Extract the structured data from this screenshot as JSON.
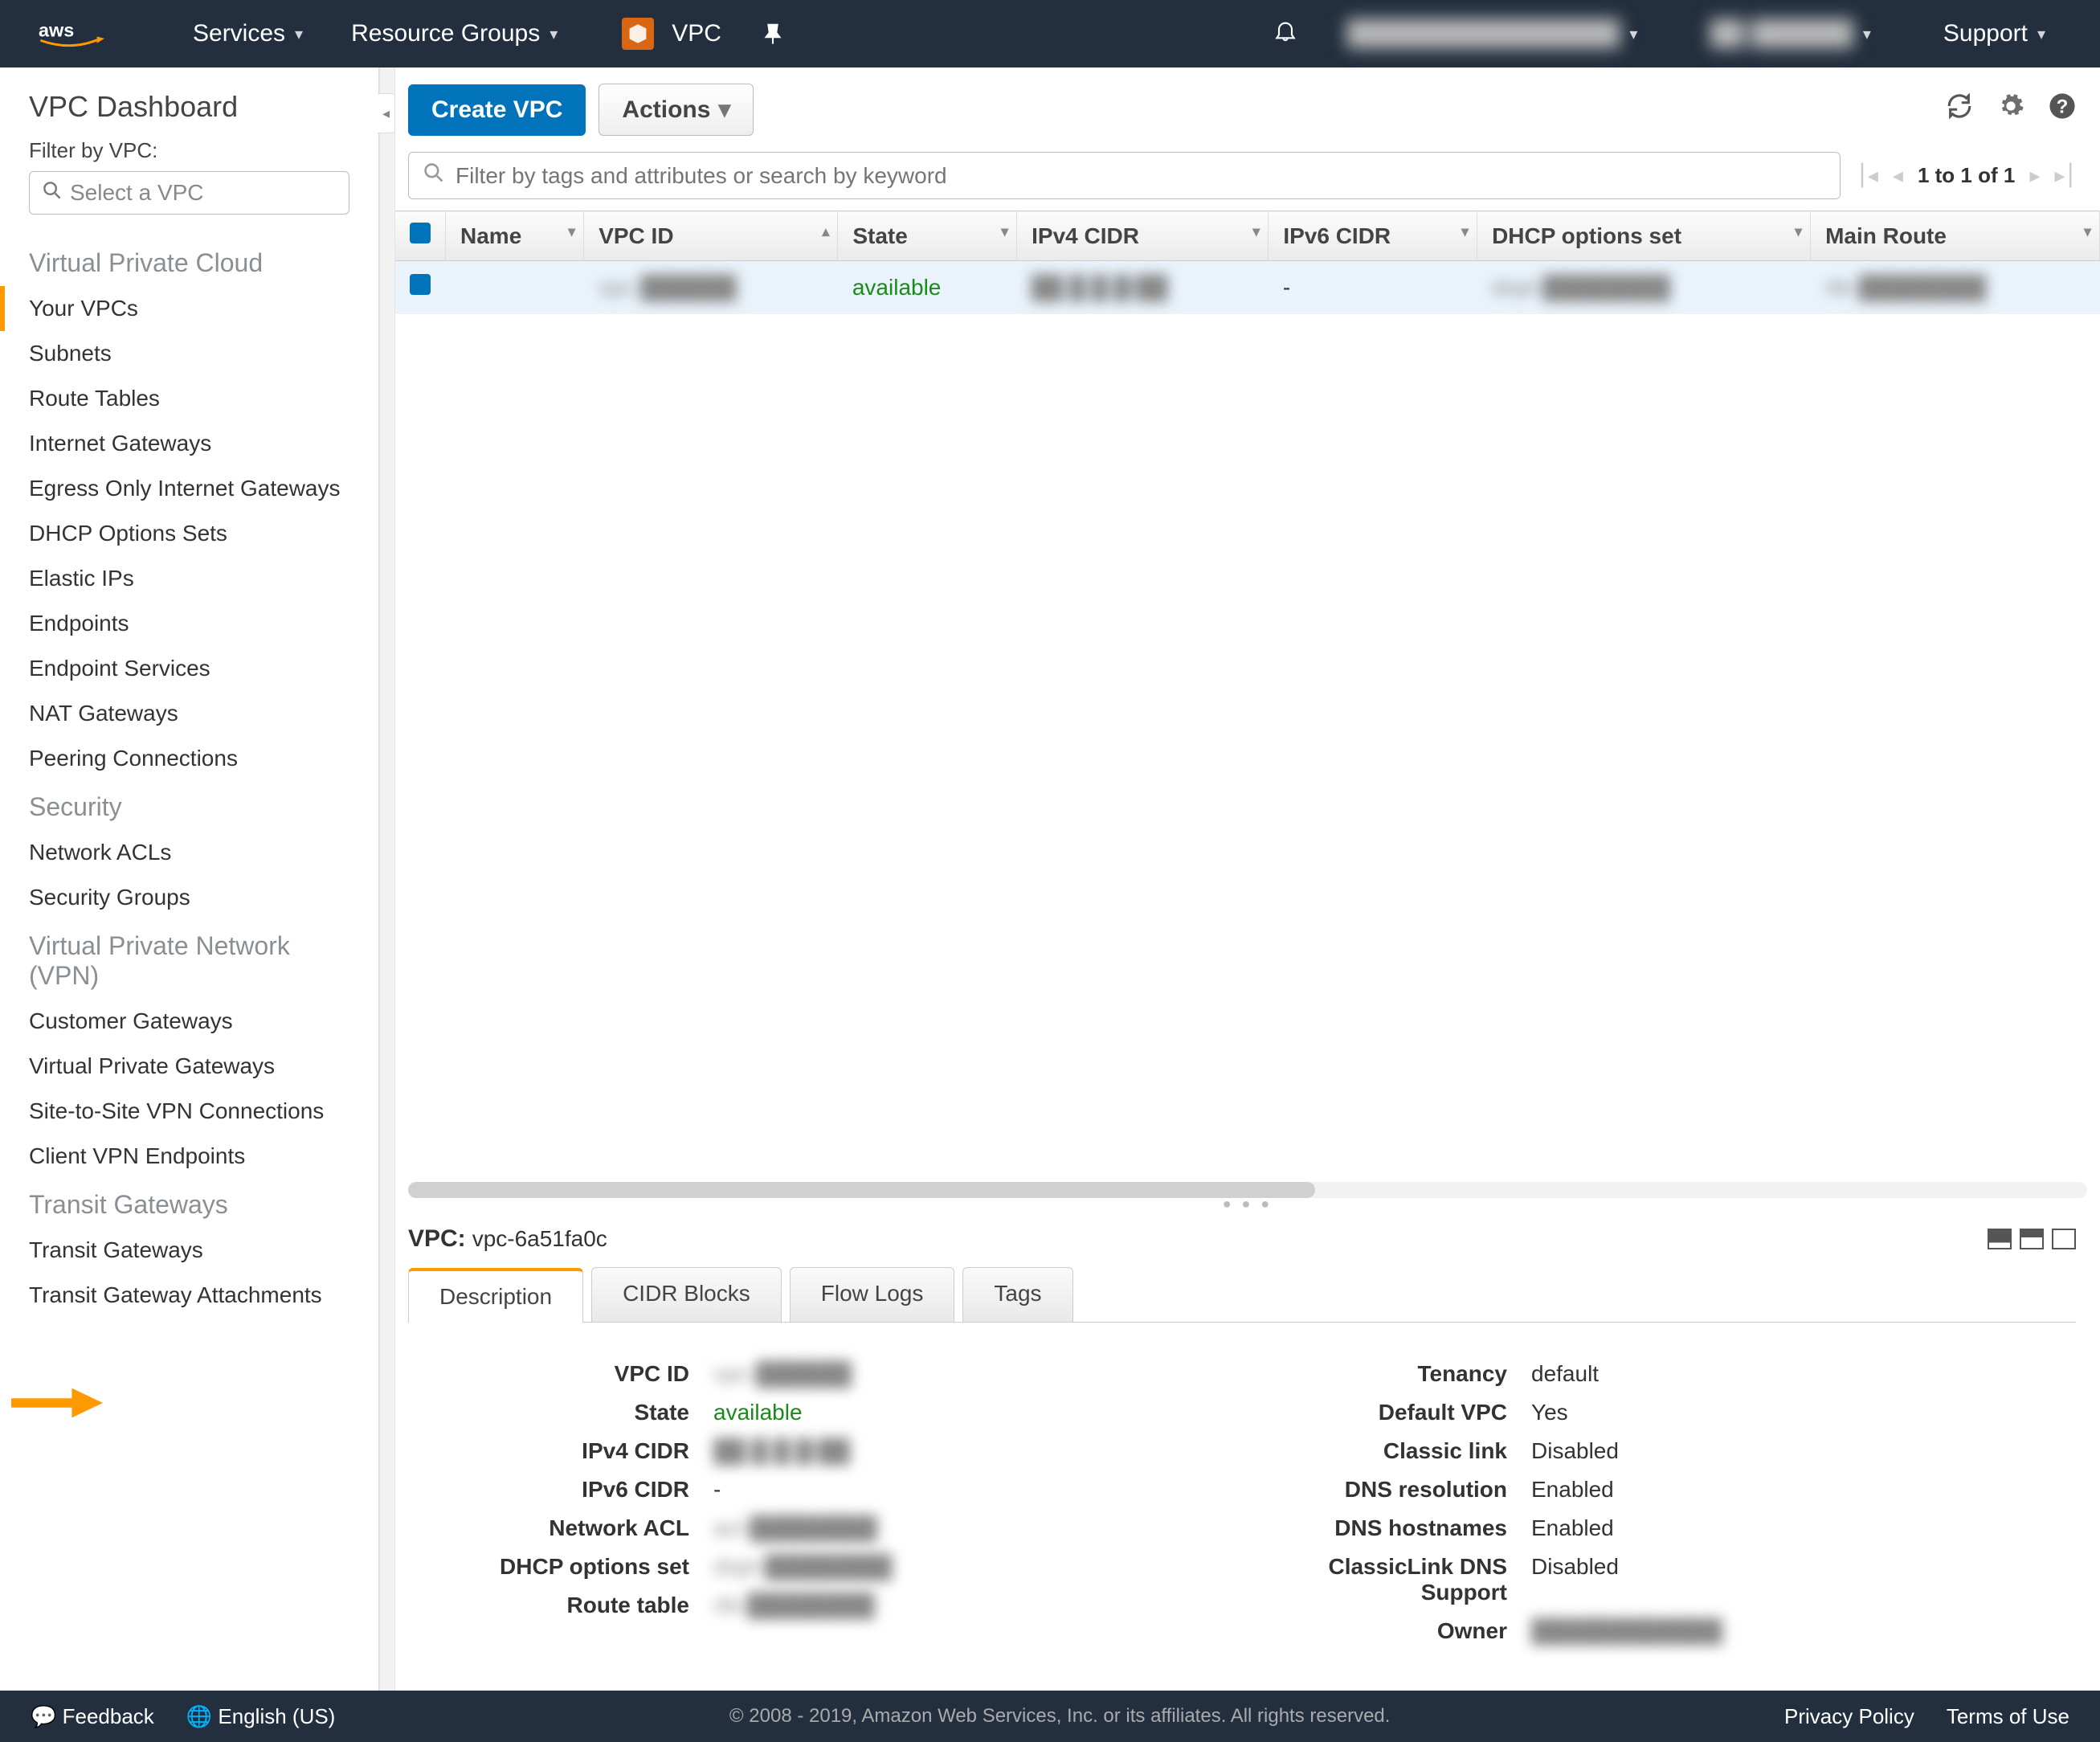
{
  "topnav": {
    "services": "Services",
    "resource_groups": "Resource Groups",
    "vpc_label": "VPC",
    "support": "Support",
    "account_blur": "████████████████",
    "region_blur": "██ ██████"
  },
  "sidebar": {
    "title": "VPC Dashboard",
    "filter_label": "Filter by VPC:",
    "select_placeholder": "Select a VPC",
    "groups": [
      {
        "label": "Virtual Private Cloud",
        "items": [
          {
            "label": "Your VPCs",
            "active": true
          },
          {
            "label": "Subnets"
          },
          {
            "label": "Route Tables"
          },
          {
            "label": "Internet Gateways"
          },
          {
            "label": "Egress Only Internet Gateways"
          },
          {
            "label": "DHCP Options Sets"
          },
          {
            "label": "Elastic IPs"
          },
          {
            "label": "Endpoints"
          },
          {
            "label": "Endpoint Services"
          },
          {
            "label": "NAT Gateways"
          },
          {
            "label": "Peering Connections"
          }
        ]
      },
      {
        "label": "Security",
        "items": [
          {
            "label": "Network ACLs"
          },
          {
            "label": "Security Groups"
          }
        ]
      },
      {
        "label": "Virtual Private Network (VPN)",
        "items": [
          {
            "label": "Customer Gateways"
          },
          {
            "label": "Virtual Private Gateways"
          },
          {
            "label": "Site-to-Site VPN Connections"
          },
          {
            "label": "Client VPN Endpoints"
          }
        ]
      },
      {
        "label": "Transit Gateways",
        "items": [
          {
            "label": "Transit Gateways"
          },
          {
            "label": "Transit Gateway Attachments"
          }
        ]
      }
    ]
  },
  "toolbar": {
    "create": "Create VPC",
    "actions": "Actions"
  },
  "search": {
    "placeholder": "Filter by tags and attributes or search by keyword"
  },
  "pager": {
    "range": "1 to 1 of 1"
  },
  "table": {
    "headers": [
      "",
      "Name",
      "VPC ID",
      "State",
      "IPv4 CIDR",
      "IPv6 CIDR",
      "DHCP options set",
      "Main Route"
    ],
    "rows": [
      {
        "name": "",
        "vpc_id": "vpc-██████",
        "state": "available",
        "ipv4": "██.█.█.█/██",
        "ipv6": "-",
        "dhcp": "dopt-████████",
        "route": "rtb-████████"
      }
    ]
  },
  "details": {
    "header_label": "VPC:",
    "header_value": "vpc-6a51fa0c",
    "tabs": [
      "Description",
      "CIDR Blocks",
      "Flow Logs",
      "Tags"
    ],
    "left": [
      {
        "k": "VPC ID",
        "v": "vpc-██████",
        "blur": true
      },
      {
        "k": "State",
        "v": "available",
        "green": true
      },
      {
        "k": "IPv4 CIDR",
        "v": "██.█.█.█/██",
        "blur": true
      },
      {
        "k": "IPv6 CIDR",
        "v": "-"
      },
      {
        "k": "Network ACL",
        "v": "acl-████████",
        "blur": true,
        "link": true
      },
      {
        "k": "DHCP options set",
        "v": "dopt-████████",
        "blur": true,
        "link": true
      },
      {
        "k": "Route table",
        "v": "rtb-████████",
        "blur": true,
        "link": true
      }
    ],
    "right": [
      {
        "k": "Tenancy",
        "v": "default"
      },
      {
        "k": "Default VPC",
        "v": "Yes"
      },
      {
        "k": "Classic link",
        "v": "Disabled"
      },
      {
        "k": "DNS resolution",
        "v": "Enabled"
      },
      {
        "k": "DNS hostnames",
        "v": "Enabled"
      },
      {
        "k": "ClassicLink DNS Support",
        "v": "Disabled"
      },
      {
        "k": "Owner",
        "v": "████████████",
        "blur": true
      }
    ]
  },
  "footer": {
    "feedback": "Feedback",
    "lang": "English (US)",
    "copyright": "© 2008 - 2019, Amazon Web Services, Inc. or its affiliates. All rights reserved.",
    "privacy": "Privacy Policy",
    "terms": "Terms of Use"
  }
}
